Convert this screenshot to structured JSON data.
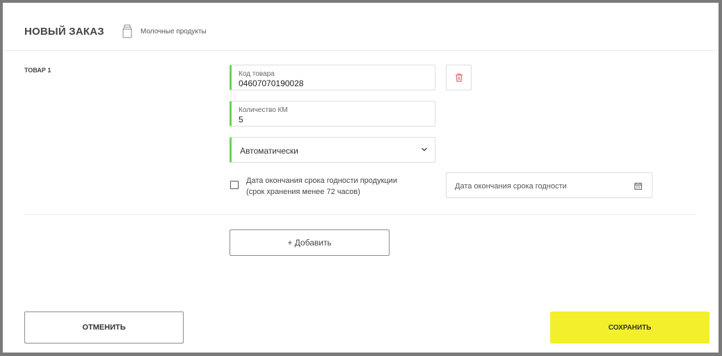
{
  "header": {
    "title": "НОВЫЙ ЗАКАЗ",
    "category_icon": "milk-carton-icon",
    "category_label": "Молочные продукты"
  },
  "item": {
    "label": "ТОВАР 1",
    "code": {
      "label": "Код товара",
      "value": "04607070190028"
    },
    "quantity": {
      "label": "Количество КМ",
      "value": "5"
    },
    "mode_select": {
      "selected": "Автоматически"
    },
    "delete_icon": "trash-icon",
    "expiry_checkbox": {
      "checked": false,
      "label_line1": "Дата окончания срока годности продукции",
      "label_line2": "(срок хранения менее 72 часов)"
    },
    "expiry_date": {
      "placeholder": "Дата окончания срока годности",
      "icon": "calendar-icon"
    }
  },
  "actions": {
    "add_label": "+ Добавить",
    "cancel_label": "ОТМЕНИТЬ",
    "save_label": "СОХРАНИТЬ"
  },
  "colors": {
    "accent_valid": "#6bd35a",
    "save_button": "#f3ef2c",
    "delete_icon": "#e86a6a"
  }
}
